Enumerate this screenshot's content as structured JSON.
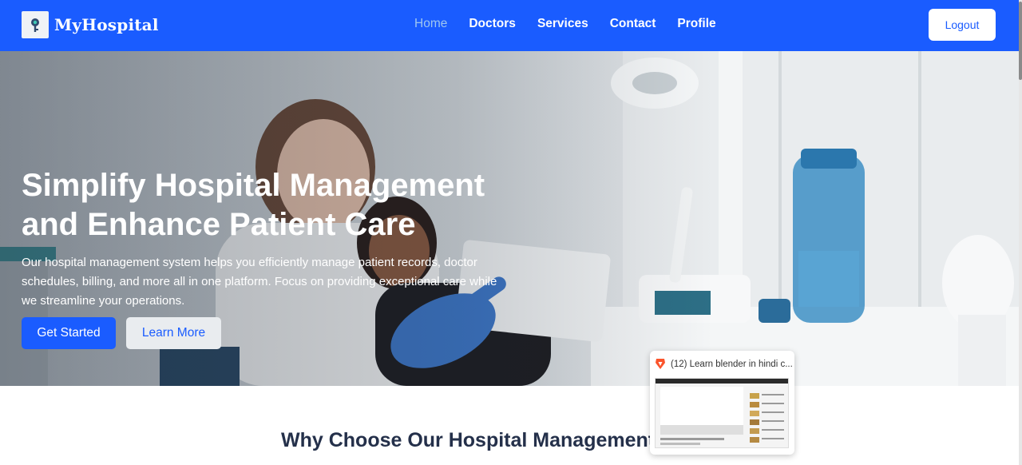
{
  "brand": {
    "name": "MyHospital",
    "logo_icon": "medical-key-icon"
  },
  "nav": {
    "items": [
      {
        "label": "Home",
        "active": true
      },
      {
        "label": "Doctors",
        "active": false
      },
      {
        "label": "Services",
        "active": false
      },
      {
        "label": "Contact",
        "active": false
      },
      {
        "label": "Profile",
        "active": false
      }
    ],
    "logout_label": "Logout"
  },
  "hero": {
    "title_line1": "Simplify Hospital Management",
    "title_line2": "and Enhance Patient Care",
    "description": "Our hospital management system helps you efficiently manage patient records, doctor schedules, billing, and more all in one platform. Focus on providing exceptional care while we streamline your operations.",
    "primary_button": "Get Started",
    "secondary_button": "Learn More"
  },
  "section": {
    "title": "Why Choose Our Hospital Management"
  },
  "pip_popup": {
    "title": "(12) Learn blender in hindi c...",
    "icon": "brave-lion-icon"
  },
  "colors": {
    "accent": "#1a5cff",
    "nav_active": "#9ec6f0",
    "heading": "#24304a"
  }
}
